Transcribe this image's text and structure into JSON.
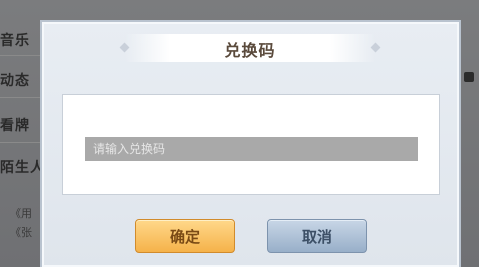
{
  "background": {
    "menu_items": [
      "音乐",
      "动态",
      "看牌",
      "陌生人"
    ],
    "footer_lines": [
      "《用",
      "《张"
    ]
  },
  "dialog": {
    "title": "兑换码",
    "input": {
      "placeholder": "请输入兑换码",
      "value": ""
    },
    "confirm_label": "确定",
    "cancel_label": "取消"
  },
  "colors": {
    "confirm_button": "#f5b24a",
    "cancel_button": "#98afc9",
    "input_bg": "#a9a9a9"
  }
}
